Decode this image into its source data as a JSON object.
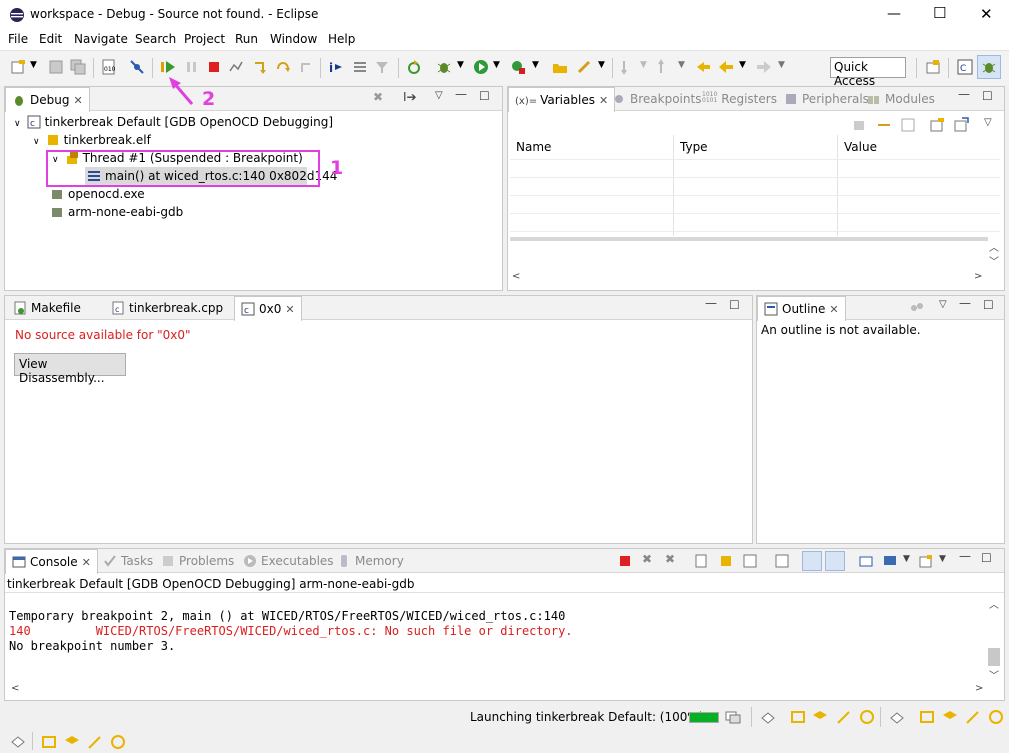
{
  "window": {
    "title": "workspace - Debug - Source not found. - Eclipse",
    "min_icon": "—",
    "max_icon": "☐",
    "close_icon": "✕"
  },
  "menu": [
    "File",
    "Edit",
    "Navigate",
    "Search",
    "Project",
    "Run",
    "Window",
    "Help"
  ],
  "toolbar": {
    "quick_access": "Quick Access"
  },
  "debug_view": {
    "tab_label": "Debug",
    "tree": {
      "launch": "tinkerbreak Default [GDB OpenOCD Debugging]",
      "elf": "tinkerbreak.elf",
      "thread": "Thread #1 (Suspended : Breakpoint)",
      "frame": "main() at wiced_rtos.c:140 0x802d144",
      "openocd": "openocd.exe",
      "gdb": "arm-none-eabi-gdb"
    },
    "annotation_1": "1",
    "annotation_2": "2"
  },
  "variables_view": {
    "tabs": [
      "Variables",
      "Breakpoints",
      "Registers",
      "Peripherals",
      "Modules"
    ],
    "variables_prefix": "(x)=",
    "registers_prefix": "1010\n0101",
    "columns": [
      "Name",
      "Type",
      "Value"
    ]
  },
  "editor": {
    "tabs": [
      "Makefile",
      "tinkerbreak.cpp",
      "0x0"
    ],
    "message": "No source available for \"0x0\"",
    "button": "View Disassembly..."
  },
  "outline_view": {
    "tab_label": "Outline",
    "message": "An outline is not available."
  },
  "console_view": {
    "tabs": [
      "Console",
      "Tasks",
      "Problems",
      "Executables",
      "Memory"
    ],
    "header": "tinkerbreak Default [GDB OpenOCD Debugging] arm-none-eabi-gdb",
    "lines": [
      {
        "text": "Temporary breakpoint 2, main () at WICED/RTOS/FreeRTOS/WICED/wiced_rtos.c:140",
        "color": "#000000"
      },
      {
        "text": "140\t    WICED/RTOS/FreeRTOS/WICED/wiced_rtos.c: No such file or directory.",
        "color": "#d9201f"
      },
      {
        "text": "No breakpoint number 3.",
        "color": "#000000"
      }
    ]
  },
  "status": {
    "launching": "Launching tinkerbreak Default: (100%)",
    "progress": 1.0
  },
  "colors": {
    "highlight": "#e040e0",
    "error": "#d9201f",
    "selection": "#d9d9d9"
  }
}
